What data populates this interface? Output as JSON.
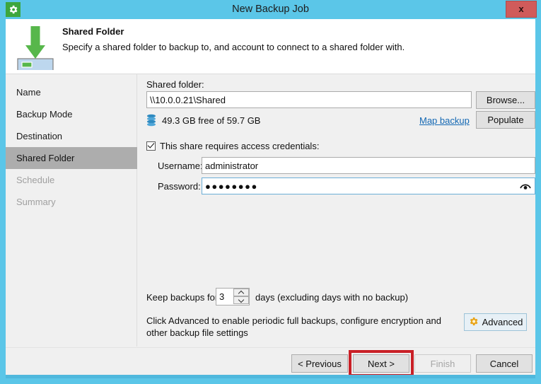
{
  "window": {
    "title": "New Backup Job",
    "app_icon": "gear-icon",
    "close_label": "x",
    "accent_color": "#5BC6E8",
    "close_color": "#D05B5B"
  },
  "header": {
    "title": "Shared Folder",
    "description": "Specify a shared folder to backup to, and account to connect to a shared folder with.",
    "icon": "download-to-drive-icon"
  },
  "sidebar": {
    "items": [
      {
        "label": "Name",
        "state": "enabled"
      },
      {
        "label": "Backup Mode",
        "state": "enabled"
      },
      {
        "label": "Destination",
        "state": "enabled"
      },
      {
        "label": "Shared Folder",
        "state": "selected"
      },
      {
        "label": "Schedule",
        "state": "disabled"
      },
      {
        "label": "Summary",
        "state": "disabled"
      }
    ],
    "selected_color": "#ADADAD"
  },
  "main": {
    "shared_folder_label": "Shared folder:",
    "shared_folder_value": "\\\\10.0.0.21\\Shared",
    "shared_folder_placeholder": "",
    "browse_label": "Browse...",
    "free_space_text": "49.3 GB free of 59.7 GB",
    "drive_icon": "storage-stack-icon",
    "map_backup_label": "Map backup",
    "map_backup_color": "#1267B3",
    "populate_label": "Populate",
    "credentials_checkbox_label": "This share requires access credentials:",
    "credentials_checked": true,
    "username_label": "Username:",
    "username_value": "administrator",
    "username_placeholder": "",
    "password_label": "Password:",
    "password_value": "●●●●●●●●",
    "password_placeholder": "",
    "reveal_icon": "eye-icon",
    "keep_backups_label": "Keep backups for:",
    "keep_backups_value": "3",
    "keep_backups_note": "days (excluding days with no backup)",
    "advanced_note": "Click Advanced to enable periodic full backups, configure encryption and other backup file settings",
    "advanced_label": "Advanced",
    "advanced_icon": "gear-icon"
  },
  "footer": {
    "previous_label": "< Previous",
    "next_label": "Next >",
    "finish_label": "Finish",
    "cancel_label": "Cancel",
    "finish_enabled": false,
    "highlight_color": "#C92027"
  }
}
